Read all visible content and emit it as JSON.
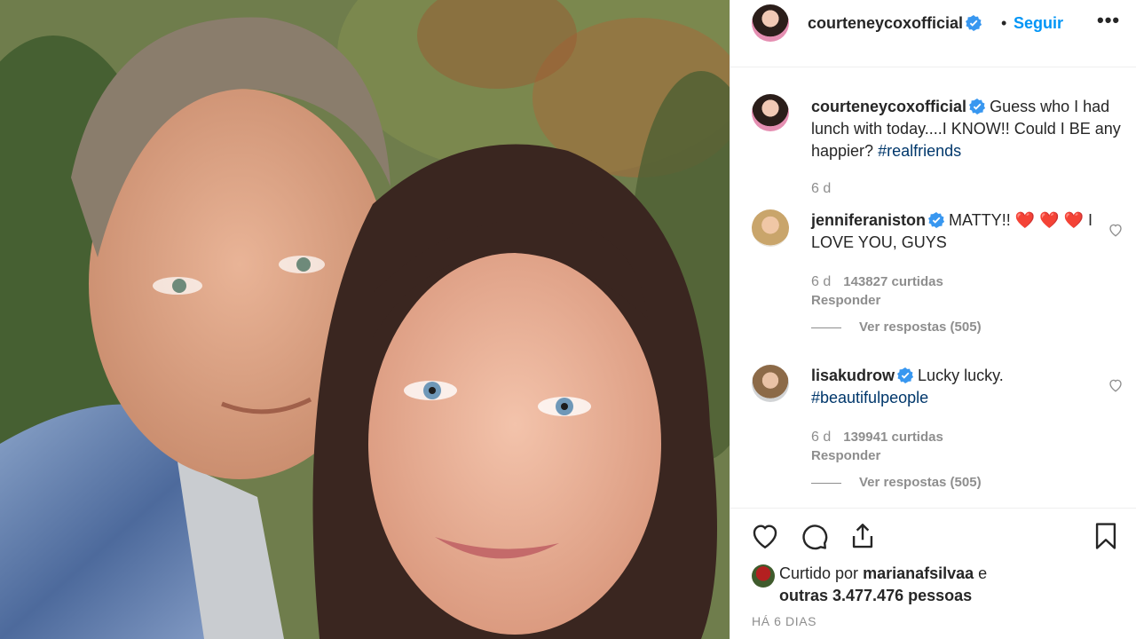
{
  "header": {
    "username": "courteneycoxofficial",
    "separator": "•",
    "follow_label": "Seguir",
    "more_label": "•••"
  },
  "caption": {
    "username": "courteneycoxofficial",
    "text": "Guess who I had lunch with today....I KNOW!! Could I BE any happier?",
    "hashtag": "#realfriends",
    "age": "6 d"
  },
  "comments": [
    {
      "username": "jenniferaniston",
      "text_before": "MATTY!!",
      "emoji": "❤️ ❤️ ❤️",
      "text_after": "I LOVE YOU, GUYS",
      "age": "6 d",
      "likes": "143827 curtidas",
      "reply_label": "Responder",
      "view_replies": "Ver respostas (505)"
    },
    {
      "username": "lisakudrow",
      "text": "Lucky lucky.",
      "hashtag": "#beautifulpeople",
      "age": "6 d",
      "likes": "139941 curtidas",
      "reply_label": "Responder",
      "view_replies": "Ver respostas (505)"
    }
  ],
  "likes_summary": {
    "prefix": "Curtido por",
    "user": "marianafsilvaa",
    "conjunction": "e",
    "others": "outras 3.477.476 pessoas"
  },
  "posted": "HÁ 6 DIAS",
  "icons": [
    "heart-icon",
    "comment-icon",
    "share-icon",
    "bookmark-icon",
    "verified-badge-icon",
    "more-options-icon"
  ],
  "colors": {
    "link": "#0095f6",
    "hashtag": "#00376b",
    "muted": "#8e8e8e",
    "verified": "#3897f0"
  }
}
